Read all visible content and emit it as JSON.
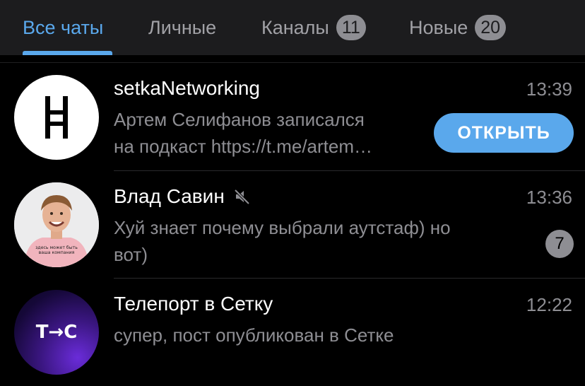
{
  "tabs": [
    {
      "label": "Все чаты",
      "active": true
    },
    {
      "label": "Личные"
    },
    {
      "label": "Каналы",
      "badge": "11"
    },
    {
      "label": "Новые",
      "badge": "20"
    }
  ],
  "chats": [
    {
      "name": "setkaNetworking",
      "time": "13:39",
      "preview_line1": "Артем Селифанов записался",
      "preview_line2": "на подкаст https://t.me/artem…",
      "action_label": "ОТКРЫТЬ",
      "avatar_icon": "setka-logo-icon"
    },
    {
      "name": "Влад Савин",
      "time": "13:36",
      "preview_line1": "Хуй знает почему выбрали аутстаф) но",
      "preview_line2": "вот)",
      "unread": "7",
      "muted": true,
      "avatar_shirt_text_1": "здесь может быть",
      "avatar_shirt_text_2": "ваша компания"
    },
    {
      "name": "Телепорт в Сетку",
      "time": "12:22",
      "preview_line1": "супер, пост опубликован в Сетке",
      "avatar_text": "Т→С"
    }
  ],
  "colors": {
    "accent": "#5aa8ec",
    "background": "#000000",
    "tabbar": "#1c1c1e",
    "secondary_text": "#8e8e93"
  }
}
